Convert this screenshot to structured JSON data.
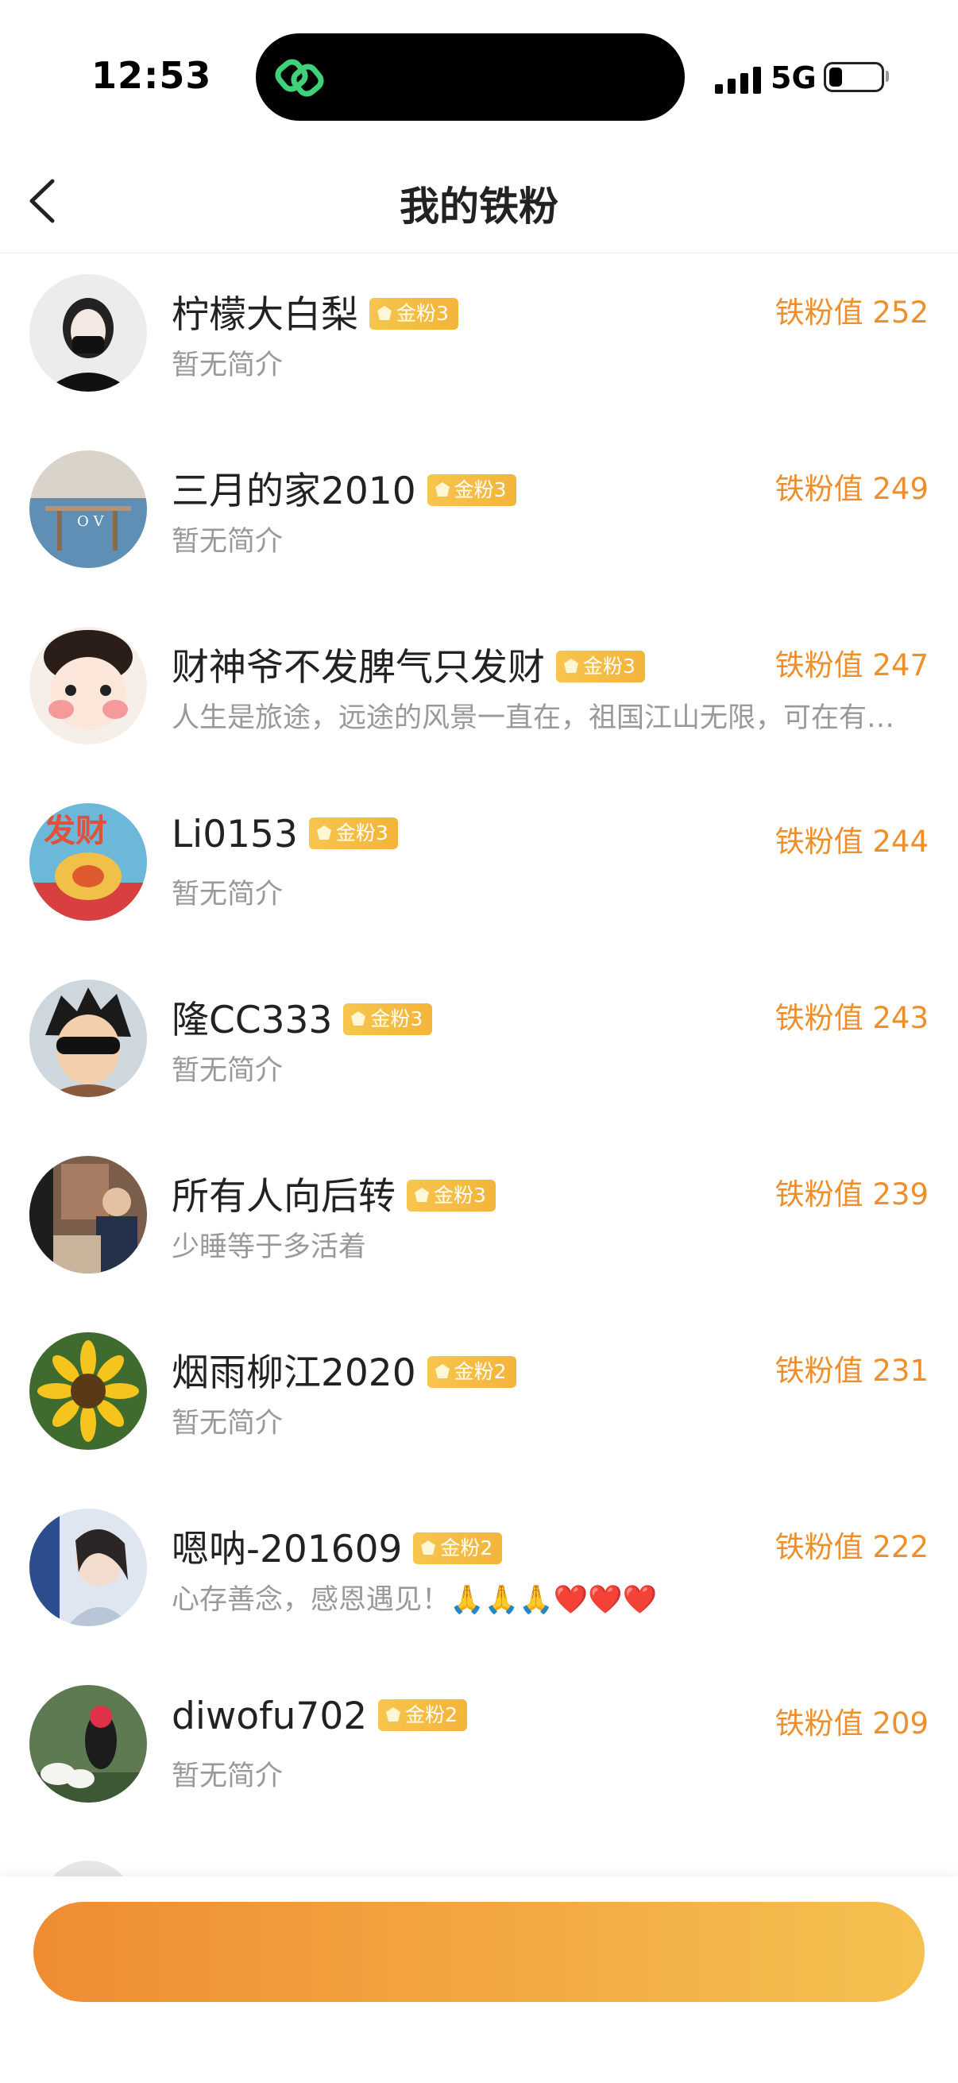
{
  "status_bar": {
    "time": "12:53",
    "network": "5G"
  },
  "header": {
    "title": "我的铁粉"
  },
  "fans": [
    {
      "name": "柠檬大白梨",
      "badge": "金粉3",
      "score": "铁粉值 252",
      "bio": "暂无简介"
    },
    {
      "name": "三月的家2010",
      "badge": "金粉3",
      "score": "铁粉值 249",
      "bio": "暂无简介"
    },
    {
      "name": "财神爷不发脾气只发财",
      "badge": "金粉3",
      "score": "铁粉值 247",
      "bio": "人生是旅途，远途的风景一直在，祖国江山无限，可在有…"
    },
    {
      "name": "Li0153",
      "badge": "金粉3",
      "score": "铁粉值 244",
      "bio": "暂无简介"
    },
    {
      "name": "隆CC333",
      "badge": "金粉3",
      "score": "铁粉值 243",
      "bio": "暂无简介"
    },
    {
      "name": "所有人向后转",
      "badge": "金粉3",
      "score": "铁粉值 239",
      "bio": "少睡等于多活着"
    },
    {
      "name": "烟雨柳江2020",
      "badge": "金粉2",
      "score": "铁粉值 231",
      "bio": "暂无简介"
    },
    {
      "name": "嗯呐-201609",
      "badge": "金粉2",
      "score": "铁粉值 222",
      "bio": "心存善念，感恩遇见！🙏🙏🙏❤️❤️❤️"
    },
    {
      "name": "diwofu702",
      "badge": "金粉2",
      "score": "铁粉值 209",
      "bio": "暂无简介"
    }
  ],
  "colors": {
    "accent": "#ee8f2c",
    "badge": "#f3b43a",
    "button_start": "#ef8c33",
    "button_end": "#f5c150"
  }
}
